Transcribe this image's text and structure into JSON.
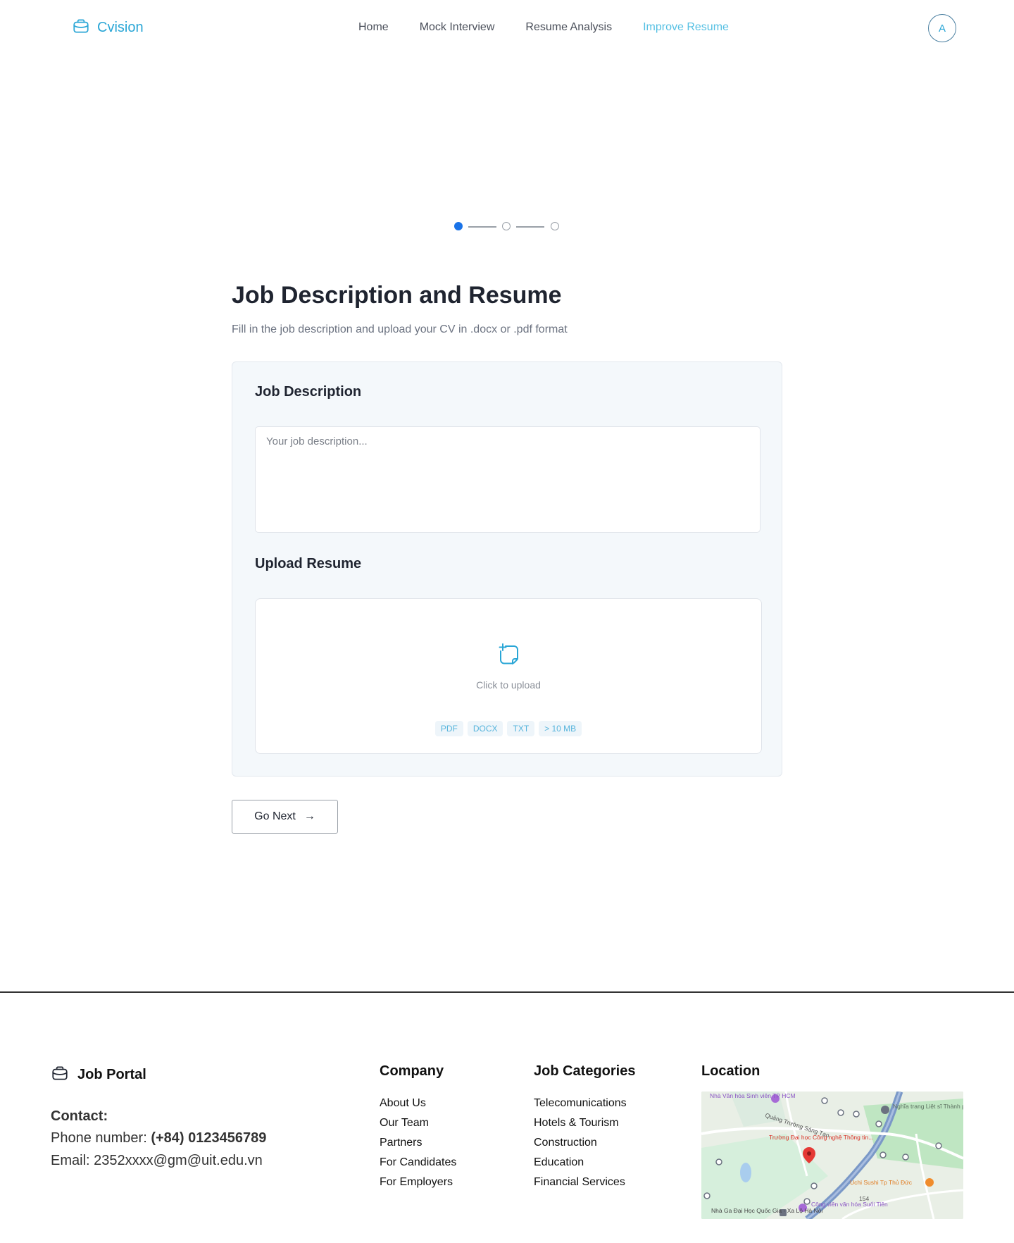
{
  "header": {
    "brand": "Cvision",
    "nav": [
      {
        "label": "Home",
        "active": false
      },
      {
        "label": "Mock Interview",
        "active": false
      },
      {
        "label": "Resume Analysis",
        "active": false
      },
      {
        "label": "Improve Resume",
        "active": true
      }
    ],
    "avatar_initial": "A"
  },
  "stepper": {
    "current_step": 1,
    "total_steps": 3
  },
  "main": {
    "title": "Job Description and Resume",
    "subtitle": "Fill in the job description and upload your CV in .docx or .pdf format",
    "job_description": {
      "heading": "Job Description",
      "placeholder": "Your job description...",
      "value": ""
    },
    "upload": {
      "heading": "Upload Resume",
      "prompt": "Click to upload",
      "formats": [
        "PDF",
        "DOCX",
        "TXT",
        "> 10 MB"
      ]
    },
    "next_button": "Go Next",
    "next_arrow": "→"
  },
  "footer": {
    "brand": "Job Portal",
    "contact_heading": "Contact:",
    "phone_label": "Phone number:",
    "phone": "(+84) 0123456789",
    "email_label": "Email:",
    "email": "2352xxxx@gm@uit.edu.vn",
    "columns": [
      {
        "heading": "Company",
        "items": [
          "About Us",
          "Our Team",
          "Partners",
          "For Candidates",
          "For Employers"
        ]
      },
      {
        "heading": "Job Categories",
        "items": [
          "Telecomunications",
          "Hotels & Tourism",
          "Construction",
          "Education",
          "Financial Services"
        ]
      }
    ],
    "location_heading": "Location",
    "map_labels": {
      "culture_house": "Nhà Văn hóa Sinh viên TP HCM",
      "cemetery": "Nghĩa trang Liệt sĩ Thành phố Hồ Chí Minh",
      "square": "Quảng Trường Sáng Tạo",
      "university": "Trường Đại học Công nghệ Thông tin...",
      "sushi": "Uchi Sushi Tp Thủ Đức",
      "station": "Nhà Ga Đại Học Quốc Gia - Xa Lộ Hà Nội",
      "park": "Công viên văn hóa Suối Tiên",
      "road": "154"
    },
    "colors": {
      "brand": "#2aa6d6",
      "step_active": "#1a73e8"
    }
  }
}
